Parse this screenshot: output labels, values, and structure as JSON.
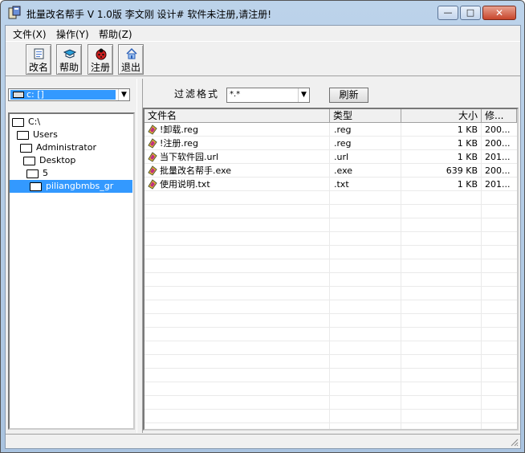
{
  "window": {
    "title": "批量改名帮手  V 1.0版  李文刚 设计#  软件未注册,请注册!",
    "minimize_glyph": "—",
    "maximize_glyph": "□",
    "close_glyph": "✕"
  },
  "menu": {
    "items": [
      {
        "label": "文件(X)"
      },
      {
        "label": "操作(Y)"
      },
      {
        "label": "帮助(Z)"
      }
    ]
  },
  "toolbar": {
    "rename_label": "改名",
    "help_label": "帮助",
    "register_label": "注册",
    "exit_label": "退出"
  },
  "drive": {
    "selected": "c: []"
  },
  "filter": {
    "label": "过滤格式",
    "value": "*.*",
    "refresh_label": "刷新"
  },
  "tree": {
    "items": [
      {
        "label": "C:\\"
      },
      {
        "label": "Users"
      },
      {
        "label": "Administrator"
      },
      {
        "label": "Desktop"
      },
      {
        "label": "5"
      },
      {
        "label": "piliangbmbs_gr"
      }
    ]
  },
  "list": {
    "headers": {
      "name": "文件名",
      "type": "类型",
      "size": "大小",
      "modified": "修..."
    },
    "rows": [
      {
        "name": "!卸载.reg",
        "type": ".reg",
        "size": "1 KB",
        "modified": "200..."
      },
      {
        "name": "!注册.reg",
        "type": ".reg",
        "size": "1 KB",
        "modified": "200..."
      },
      {
        "name": "当下软件园.url",
        "type": ".url",
        "size": "1 KB",
        "modified": "201..."
      },
      {
        "name": "批量改名帮手.exe",
        "type": ".exe",
        "size": "639 KB",
        "modified": "200..."
      },
      {
        "name": "使用说明.txt",
        "type": ".txt",
        "size": "1 KB",
        "modified": "201..."
      }
    ]
  },
  "colors": {
    "selection": "#3399ff",
    "titlebar": "#bcd3ea",
    "close": "#c8452b"
  }
}
